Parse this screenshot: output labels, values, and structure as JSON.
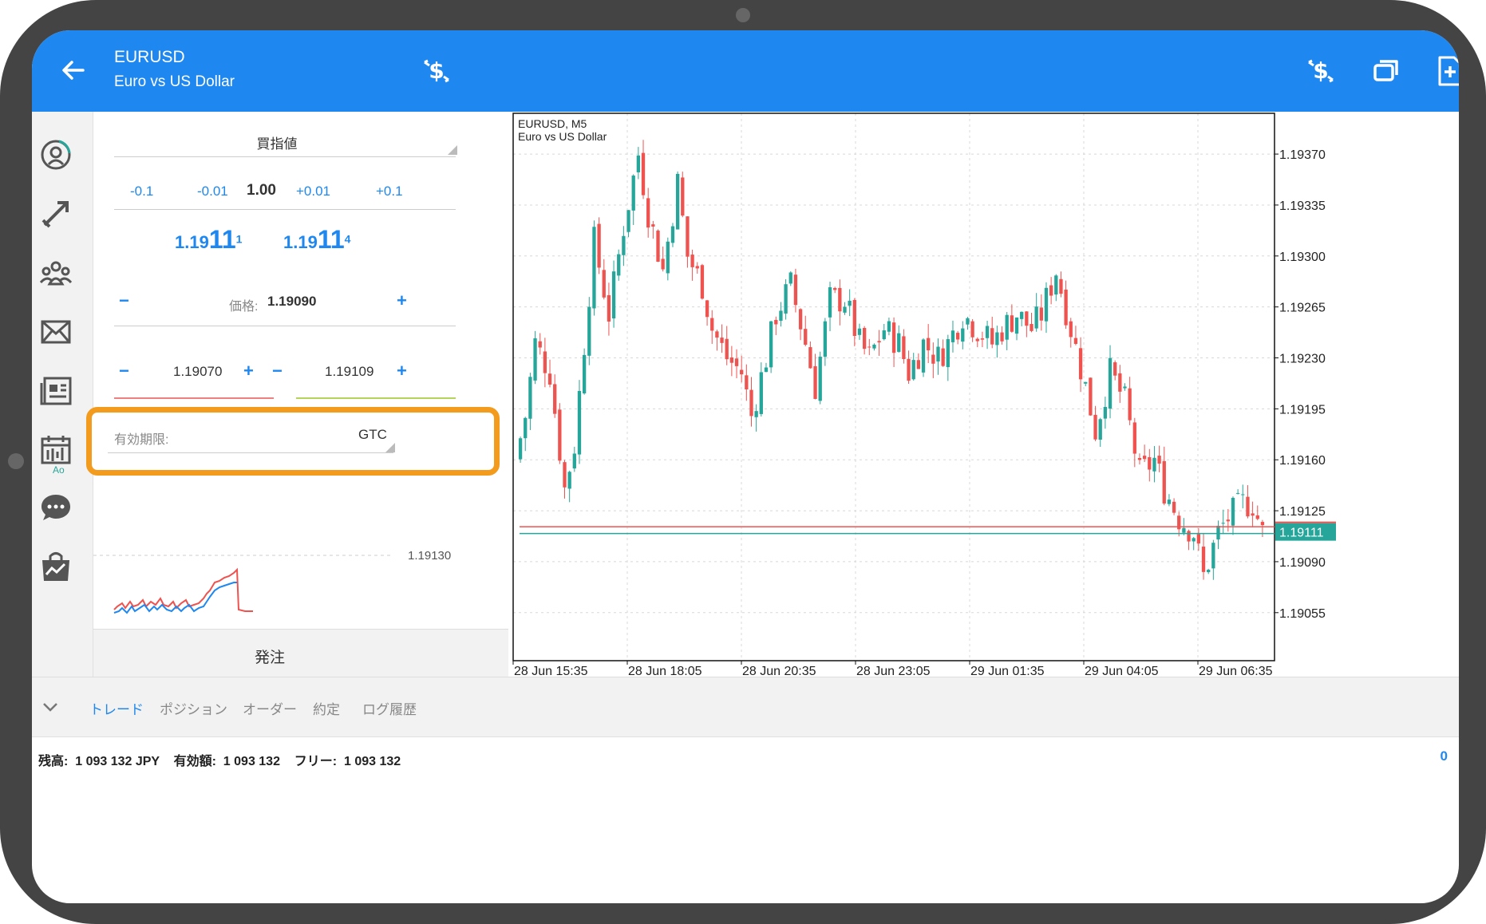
{
  "header": {
    "symbol": "EURUSD",
    "symbol_description": "Euro vs US Dollar",
    "icons": [
      "back-arrow-icon",
      "trade-icon",
      "trade-icon",
      "window-icon",
      "new-order-icon"
    ]
  },
  "rail": {
    "icons": [
      "profile-icon",
      "trade-arrows-icon",
      "community-icon",
      "mail-icon",
      "news-icon",
      "calendar-icon",
      "chat-icon",
      "market-icon"
    ],
    "calendar_badge": "Ao"
  },
  "order": {
    "order_type": "買指値",
    "volume_steps": [
      "-0.1",
      "-0.01",
      "+0.01",
      "+0.1"
    ],
    "volume": "1.00",
    "bid": {
      "prefix": "1.19",
      "big": "11",
      "sup": "1"
    },
    "ask": {
      "prefix": "1.19",
      "big": "11",
      "sup": "4"
    },
    "price_label": "価格:",
    "price_value": "1.19090",
    "sl_value": "1.19070",
    "tp_value": "1.19109",
    "minus": "−",
    "plus": "+",
    "expiry_label": "有効期限:",
    "expiry_value": "GTC",
    "mini_chart_level": "1.19130",
    "submit_label": "発注"
  },
  "colors": {
    "accent": "#1e88f0",
    "bull": "#26a69a",
    "bear": "#ef5350",
    "highlight": "#f29b1d"
  },
  "chart_data": {
    "type": "candlestick",
    "title": "EURUSD, M5",
    "subtitle": "Euro vs US Dollar",
    "x_tick_labels": [
      "28 Jun 15:35",
      "28 Jun 18:05",
      "28 Jun 20:35",
      "28 Jun 23:05",
      "29 Jun 01:35",
      "29 Jun 04:05",
      "29 Jun 06:35"
    ],
    "y_tick_labels": [
      "1.19370",
      "1.19335",
      "1.19300",
      "1.19265",
      "1.19230",
      "1.19195",
      "1.19160",
      "1.19125",
      "1.19090",
      "1.19055"
    ],
    "y_ticks": [
      1.1937,
      1.19335,
      1.193,
      1.19265,
      1.1923,
      1.19195,
      1.1916,
      1.19125,
      1.1909,
      1.19055
    ],
    "ylim": [
      1.19022,
      1.19398
    ],
    "current_price": "1.19111",
    "bid_line": 1.19111,
    "ask_line": 1.19114,
    "grid": true,
    "close_path": [
      [
        0,
        1.1916
      ],
      [
        2,
        1.1919
      ],
      [
        4,
        1.1924
      ],
      [
        7,
        1.1922
      ],
      [
        10,
        1.1914
      ],
      [
        12,
        1.1917
      ],
      [
        16,
        1.1931
      ],
      [
        19,
        1.1926
      ],
      [
        22,
        1.1932
      ],
      [
        25,
        1.1937
      ],
      [
        27,
        1.1933
      ],
      [
        30,
        1.1929
      ],
      [
        33,
        1.1935
      ],
      [
        35,
        1.193
      ],
      [
        38,
        1.1928
      ],
      [
        40,
        1.1925
      ],
      [
        43,
        1.1923
      ],
      [
        46,
        1.1922
      ],
      [
        48,
        1.1919
      ],
      [
        51,
        1.1923
      ],
      [
        53,
        1.1926
      ],
      [
        56,
        1.1928
      ],
      [
        59,
        1.1924
      ],
      [
        61,
        1.1921
      ],
      [
        64,
        1.1927
      ],
      [
        67,
        1.1927
      ],
      [
        70,
        1.1924
      ],
      [
        72,
        1.1923
      ],
      [
        75,
        1.1925
      ],
      [
        78,
        1.1924
      ],
      [
        80,
        1.1922
      ],
      [
        83,
        1.1924
      ],
      [
        86,
        1.1923
      ],
      [
        88,
        1.1924
      ],
      [
        91,
        1.1926
      ],
      [
        94,
        1.1925
      ],
      [
        97,
        1.1924
      ],
      [
        99,
        1.1925
      ],
      [
        102,
        1.1926
      ],
      [
        105,
        1.1925
      ],
      [
        107,
        1.1926
      ],
      [
        110,
        1.1929
      ],
      [
        113,
        1.1925
      ],
      [
        116,
        1.1921
      ],
      [
        118,
        1.1918
      ],
      [
        121,
        1.1922
      ],
      [
        124,
        1.192
      ],
      [
        127,
        1.1915
      ],
      [
        130,
        1.1916
      ],
      [
        132,
        1.1914
      ],
      [
        135,
        1.1912
      ],
      [
        138,
        1.1911
      ],
      [
        140,
        1.1908
      ],
      [
        143,
        1.1911
      ],
      [
        145,
        1.1912
      ],
      [
        148,
        1.1913
      ],
      [
        150,
        1.1913
      ],
      [
        152,
        1.1911
      ]
    ]
  },
  "tabs": [
    "トレード",
    "ポジション",
    "オーダー",
    "約定",
    "ログ履歴"
  ],
  "balance_line": "残高:  1 093 132 JPY    有効額:  1 093 132    フリー:  1 093 132",
  "count": "0"
}
